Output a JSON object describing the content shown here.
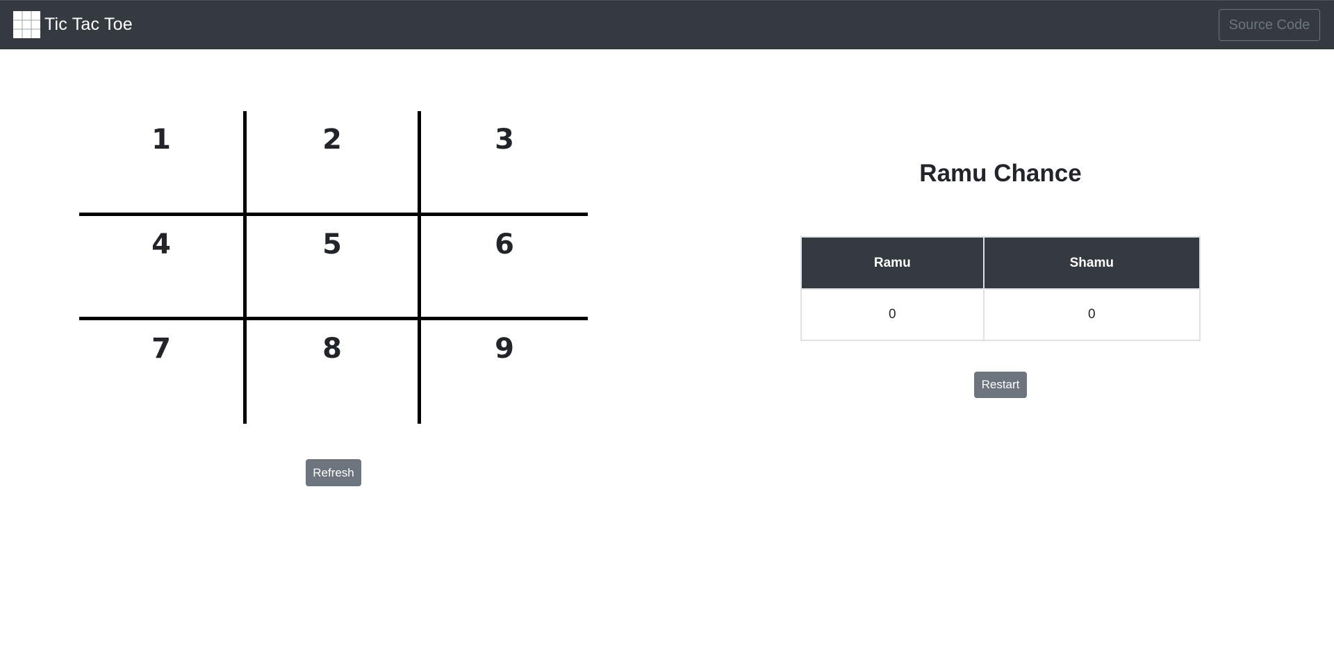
{
  "navbar": {
    "brand_text": "Tic Tac Toe",
    "brand_icon": "grid-icon",
    "source_code_label": "Source Code",
    "colors": {
      "background": "#343a40",
      "outline_button": "#6c757d"
    }
  },
  "board": {
    "cells": [
      "1",
      "2",
      "3",
      "4",
      "5",
      "6",
      "7",
      "8",
      "9"
    ],
    "refresh_label": "Refresh"
  },
  "status": {
    "turn_text": "Ramu Chance"
  },
  "scoreboard": {
    "headers": [
      "Ramu",
      "Shamu"
    ],
    "scores": [
      "0",
      "0"
    ],
    "restart_label": "Restart"
  }
}
